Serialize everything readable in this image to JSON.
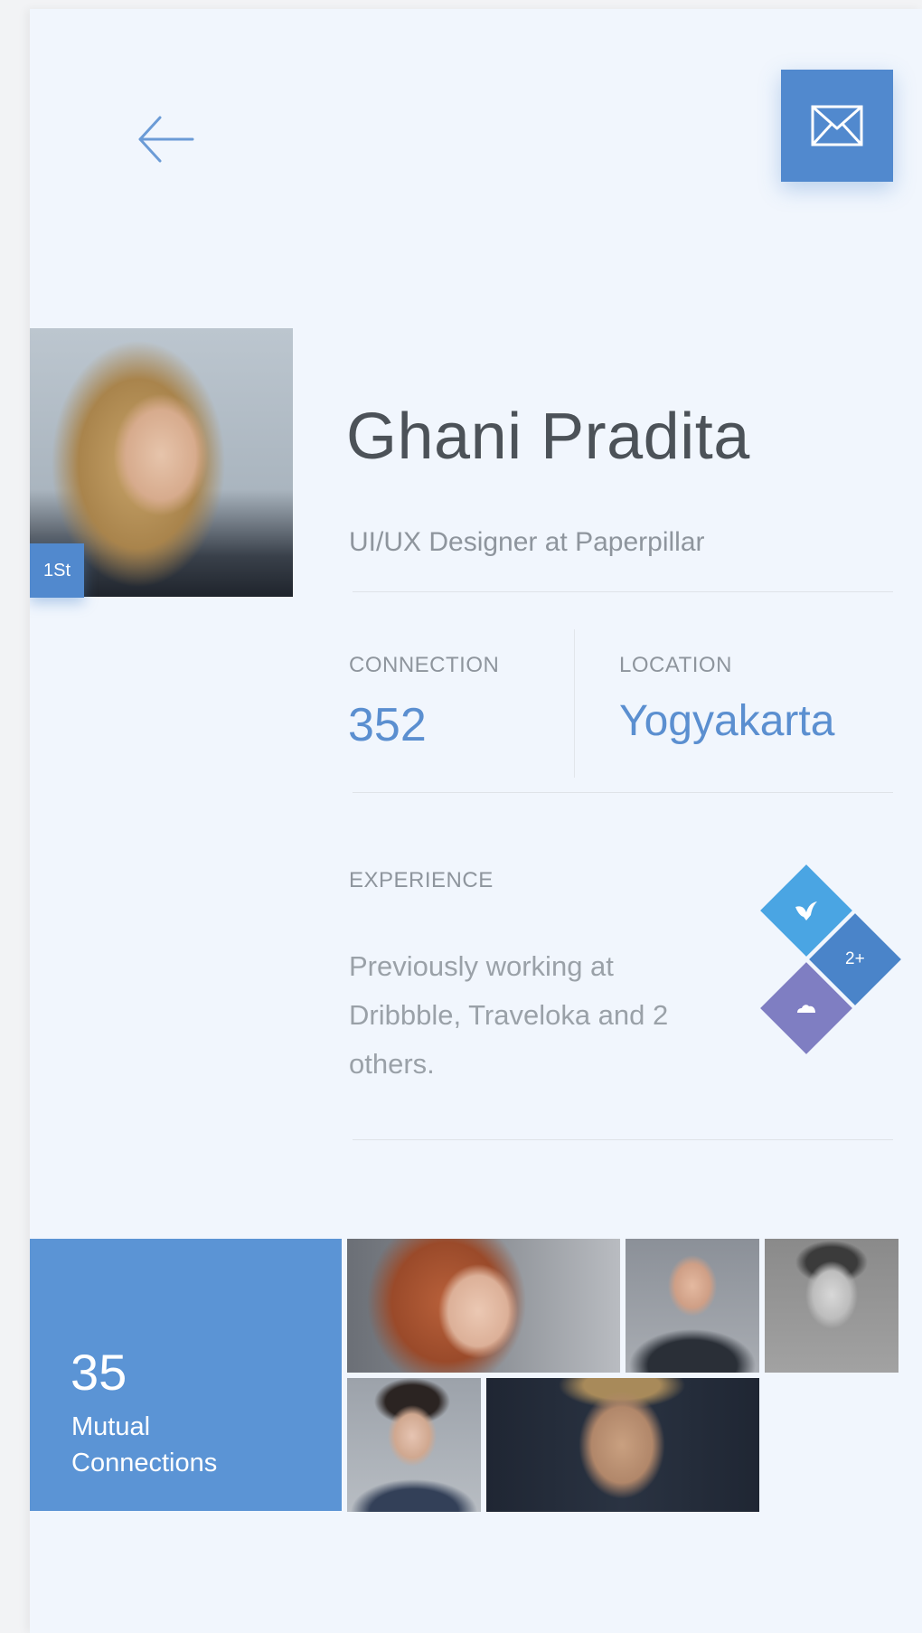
{
  "profile": {
    "name": "Ghani Pradita",
    "headline": "UI/UX Designer at Paperpillar",
    "badge": "1St"
  },
  "stats": {
    "connection": {
      "label": "CONNECTION",
      "value": "352"
    },
    "location": {
      "label": "LOCATION",
      "value": "Yogyakarta"
    }
  },
  "experience": {
    "label": "EXPERIENCE",
    "text": "Previously working at Dribbble, Traveloka and 2 others.",
    "more_label": "2+"
  },
  "mutual": {
    "count": "35",
    "label": "Mutual Connections"
  },
  "colors": {
    "accent": "#5189ce",
    "mutual_card": "#5b94d5",
    "company_1": "#4aa5e3",
    "company_2": "#4a84c9",
    "company_3": "#7f7ec2",
    "background": "#f1f6fd"
  },
  "icons": {
    "back": "arrow-left-icon",
    "mail": "envelope-icon",
    "company_1": "bird-icon",
    "company_3": "cloud-icon"
  }
}
